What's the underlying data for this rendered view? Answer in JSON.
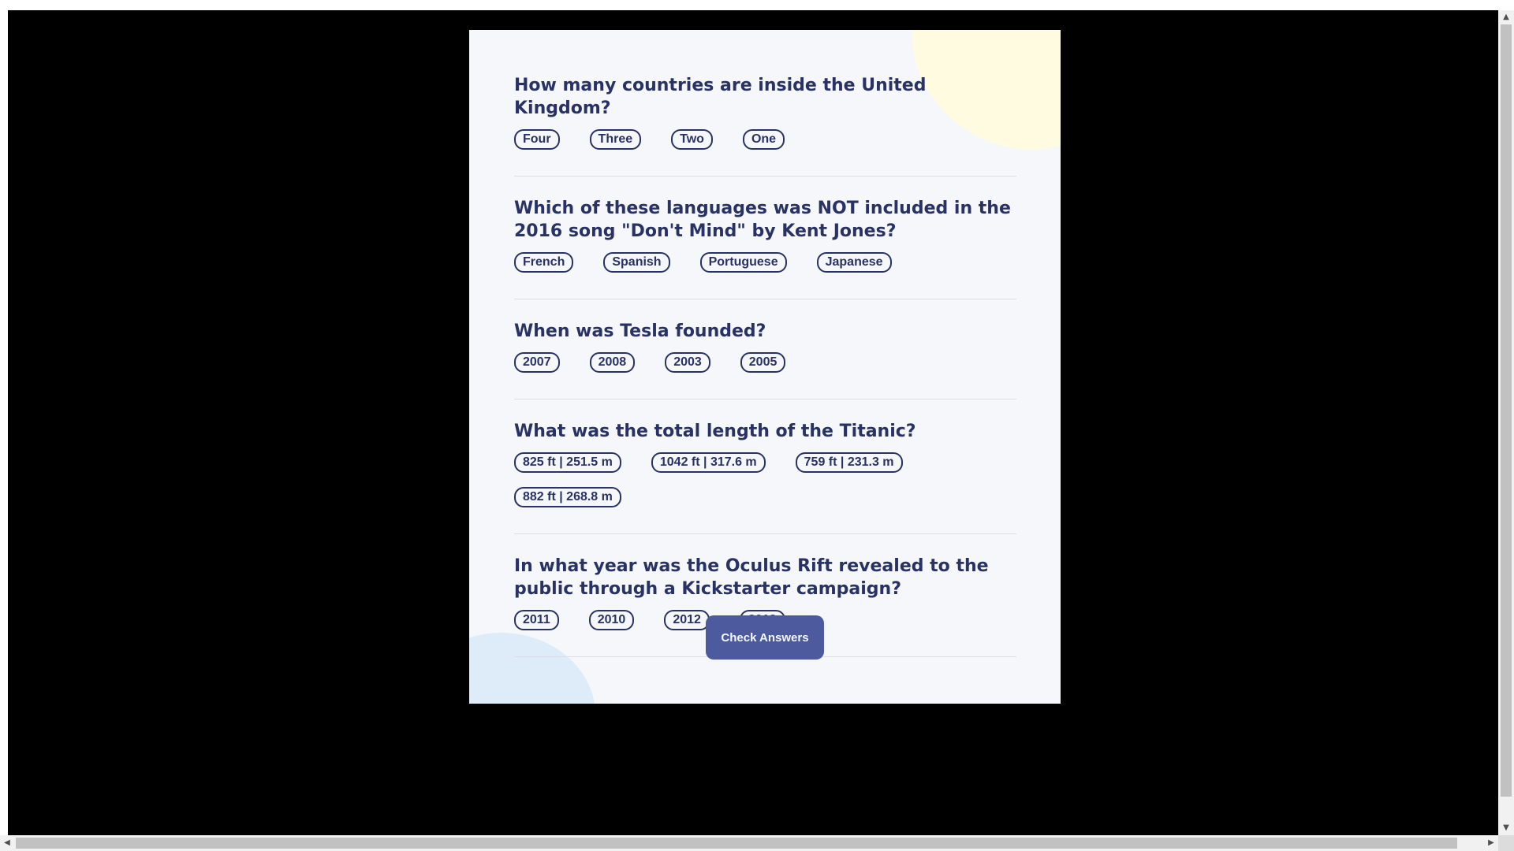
{
  "quiz": {
    "questions": [
      {
        "text": "How many countries are inside the United Kingdom?",
        "answers": [
          "Four",
          "Three",
          "Two",
          "One"
        ]
      },
      {
        "text": "Which of these languages was NOT included in the 2016 song \"Don't Mind\" by Kent Jones?",
        "answers": [
          "French",
          "Spanish",
          "Portuguese",
          "Japanese"
        ]
      },
      {
        "text": "When was Tesla founded?",
        "answers": [
          "2007",
          "2008",
          "2003",
          "2005"
        ]
      },
      {
        "text": "What was the total length of the Titanic?",
        "answers": [
          "825 ft | 251.5 m",
          "1042 ft | 317.6 m",
          "759 ft | 231.3 m",
          "882 ft | 268.8 m"
        ]
      },
      {
        "text": "In what year was the Oculus Rift revealed to the public through a Kickstarter campaign?",
        "answers": [
          "2011",
          "2010",
          "2012",
          "2013"
        ]
      }
    ],
    "check_label": "Check Answers"
  },
  "colors": {
    "question_text": "#293264",
    "answer_border": "#293264",
    "button_bg": "#4d5b9e",
    "card_bg": "#f5f7fb",
    "blob_yellow": "#fffbe0",
    "blob_blue": "#deebf8"
  },
  "scrollbar": {
    "up_icon": "▲",
    "down_icon": "▼",
    "left_icon": "◀",
    "right_icon": "▶"
  }
}
